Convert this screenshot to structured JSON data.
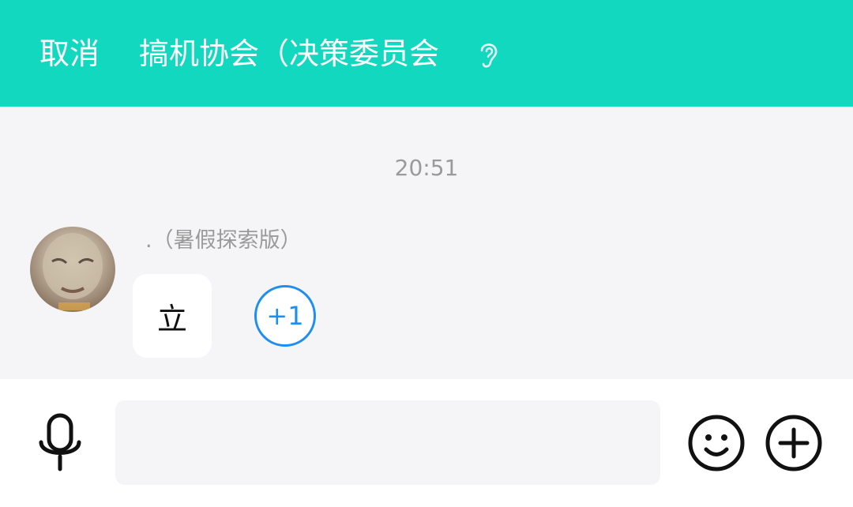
{
  "header": {
    "cancel_label": "取消",
    "title": "搞机协会（决策委员会",
    "background_color": "#12d8c0",
    "ear_icon": "ear-icon"
  },
  "chat": {
    "timestamp": "20:51",
    "messages": [
      {
        "sender": ".（暑假探索版）",
        "text": "立",
        "plus_one_label": "+1",
        "accent_color": "#1f8ef1"
      }
    ]
  },
  "input_bar": {
    "mic_icon": "microphone-icon",
    "input_value": "",
    "emoji_icon": "smiley-icon",
    "plus_icon": "plus-circle-icon"
  }
}
